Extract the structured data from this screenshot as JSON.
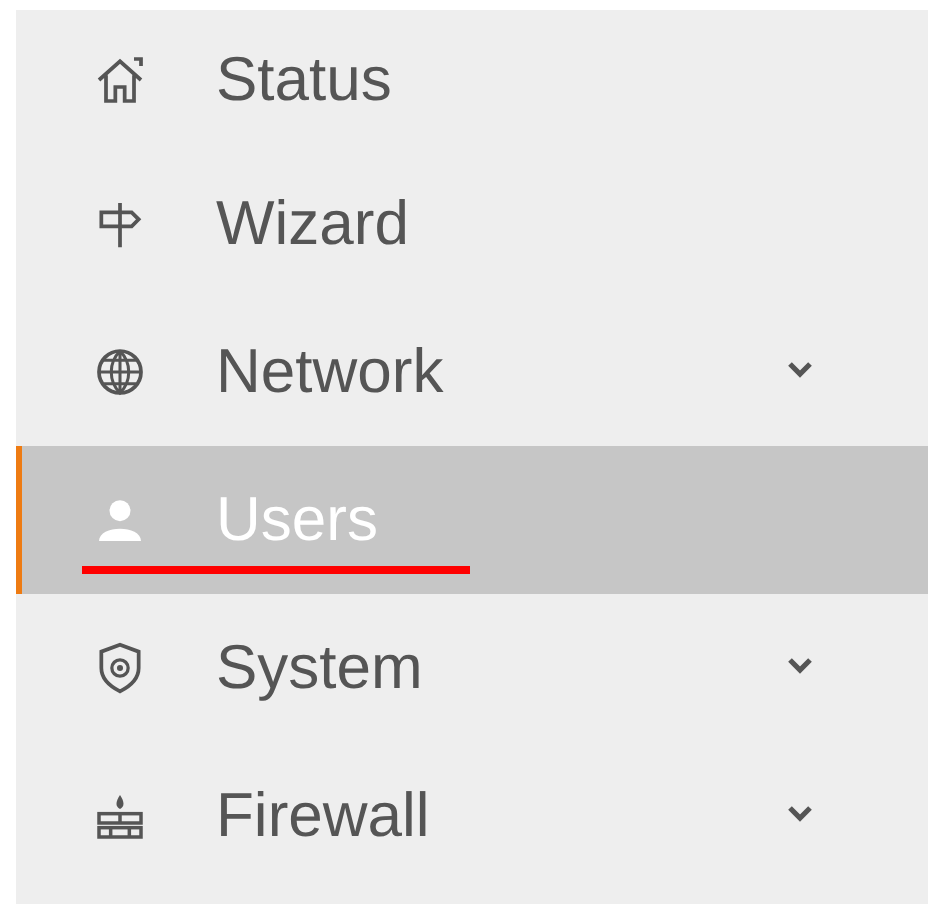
{
  "menu": {
    "items": [
      {
        "label": "Status",
        "selected": false,
        "expandable": false,
        "underlined": false
      },
      {
        "label": "Wizard",
        "selected": false,
        "expandable": false,
        "underlined": false
      },
      {
        "label": "Network",
        "selected": false,
        "expandable": true,
        "underlined": false
      },
      {
        "label": "Users",
        "selected": true,
        "expandable": false,
        "underlined": true
      },
      {
        "label": "System",
        "selected": false,
        "expandable": true,
        "underlined": false
      },
      {
        "label": "Firewall",
        "selected": false,
        "expandable": true,
        "underlined": false
      }
    ]
  }
}
